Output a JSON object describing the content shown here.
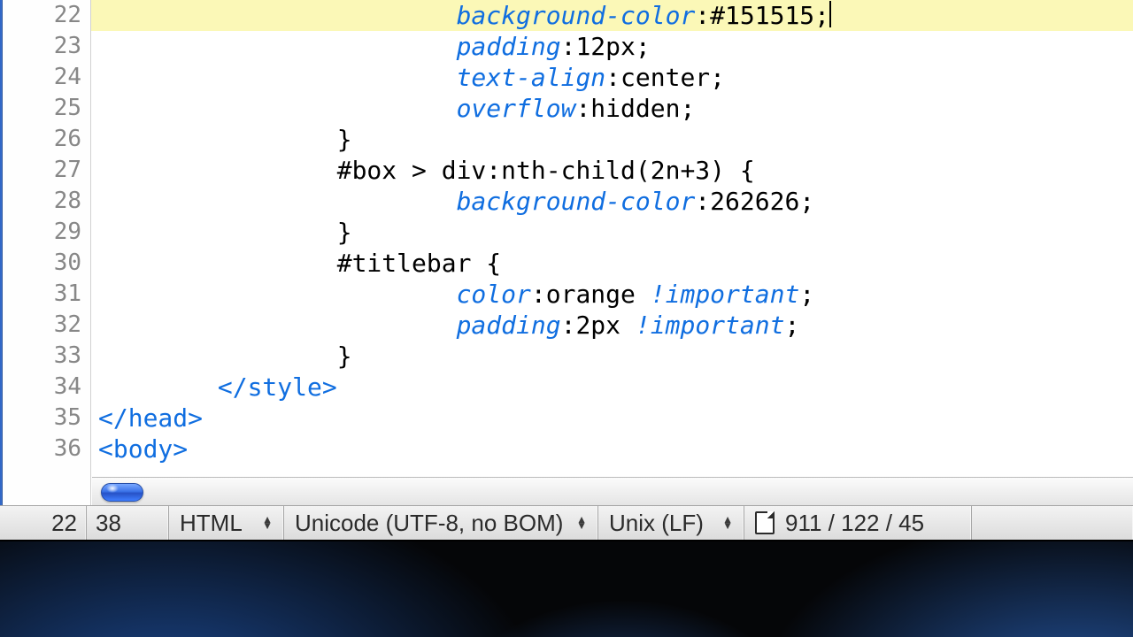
{
  "gutter": {
    "start": 22,
    "end": 36
  },
  "current_line": 22,
  "lines": {
    "22": {
      "indent": "                        ",
      "tokens": [
        {
          "cls": "t-prop",
          "text": "background-color"
        },
        {
          "cls": "t-punc",
          "text": ":"
        },
        {
          "cls": "t-val",
          "text": "#151515;"
        }
      ],
      "cursor_after": true
    },
    "23": {
      "indent": "                        ",
      "tokens": [
        {
          "cls": "t-prop",
          "text": "padding"
        },
        {
          "cls": "t-punc",
          "text": ":"
        },
        {
          "cls": "t-val",
          "text": "12px;"
        }
      ]
    },
    "24": {
      "indent": "                        ",
      "tokens": [
        {
          "cls": "t-prop",
          "text": "text-align"
        },
        {
          "cls": "t-punc",
          "text": ":"
        },
        {
          "cls": "t-val",
          "text": "center;"
        }
      ]
    },
    "25": {
      "indent": "                        ",
      "tokens": [
        {
          "cls": "t-prop",
          "text": "overflow"
        },
        {
          "cls": "t-punc",
          "text": ":"
        },
        {
          "cls": "t-val",
          "text": "hidden;"
        }
      ]
    },
    "26": {
      "indent": "                ",
      "tokens": [
        {
          "cls": "t-punc",
          "text": "}"
        }
      ]
    },
    "27": {
      "indent": "                ",
      "tokens": [
        {
          "cls": "t-sel",
          "text": "#box > div:nth-child(2n+3) {"
        }
      ]
    },
    "28": {
      "indent": "                        ",
      "tokens": [
        {
          "cls": "t-prop",
          "text": "background-color"
        },
        {
          "cls": "t-punc",
          "text": ":"
        },
        {
          "cls": "t-val",
          "text": "262626;"
        }
      ]
    },
    "29": {
      "indent": "                ",
      "tokens": [
        {
          "cls": "t-punc",
          "text": "}"
        }
      ]
    },
    "30": {
      "indent": "                ",
      "tokens": [
        {
          "cls": "t-sel",
          "text": "#titlebar {"
        }
      ]
    },
    "31": {
      "indent": "                        ",
      "tokens": [
        {
          "cls": "t-prop",
          "text": "color"
        },
        {
          "cls": "t-punc",
          "text": ":"
        },
        {
          "cls": "t-val",
          "text": "orange "
        },
        {
          "cls": "t-important",
          "text": "!important"
        },
        {
          "cls": "t-punc",
          "text": ";"
        }
      ]
    },
    "32": {
      "indent": "                        ",
      "tokens": [
        {
          "cls": "t-prop",
          "text": "padding"
        },
        {
          "cls": "t-punc",
          "text": ":"
        },
        {
          "cls": "t-val",
          "text": "2px "
        },
        {
          "cls": "t-important",
          "text": "!important"
        },
        {
          "cls": "t-punc",
          "text": ";"
        }
      ]
    },
    "33": {
      "indent": "                ",
      "tokens": [
        {
          "cls": "t-punc",
          "text": "}"
        }
      ]
    },
    "34": {
      "indent": "        ",
      "tokens": [
        {
          "cls": "t-tagpunc",
          "text": "</"
        },
        {
          "cls": "t-tag",
          "text": "style"
        },
        {
          "cls": "t-tagpunc",
          "text": ">"
        }
      ]
    },
    "35": {
      "indent": "",
      "tokens": [
        {
          "cls": "t-tagpunc",
          "text": "</"
        },
        {
          "cls": "t-tag",
          "text": "head"
        },
        {
          "cls": "t-tagpunc",
          "text": ">"
        }
      ]
    },
    "36": {
      "indent": "",
      "tokens": [
        {
          "cls": "t-tagpunc",
          "text": "<"
        },
        {
          "cls": "t-tag",
          "text": "body"
        },
        {
          "cls": "t-tagpunc",
          "text": ">"
        }
      ]
    }
  },
  "status": {
    "line": "22",
    "col": "38",
    "language": "HTML",
    "encoding": "Unicode (UTF-8, no BOM)",
    "line_endings": "Unix (LF)",
    "file_counts": "911 / 122 / 45"
  }
}
